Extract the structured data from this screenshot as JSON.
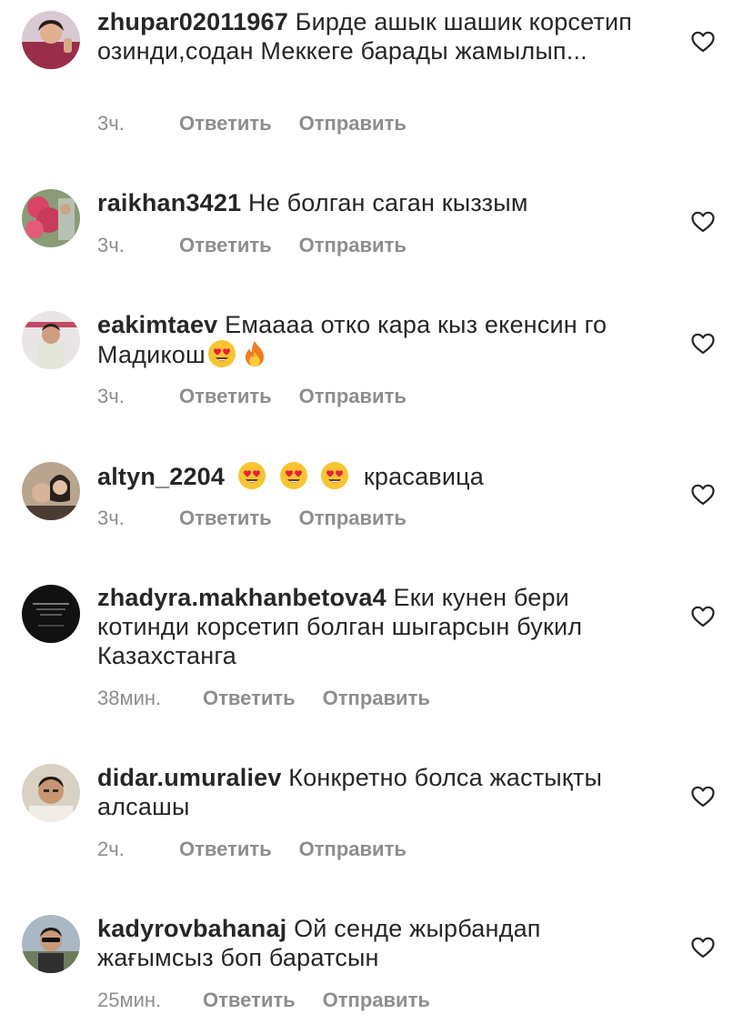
{
  "icons": {
    "like": "heart-outline-icon",
    "heart_eyes": "smiling-face-with-heart-eyes-emoji",
    "fire": "fire-emoji"
  },
  "colors": {
    "text": "#262626",
    "secondary": "#8e8e8e",
    "emoji_face": "#f9c432",
    "emoji_heart": "#e8213a",
    "fire_outer": "#f5791f",
    "fire_inner": "#ffcb3d"
  },
  "comments": [
    {
      "username": "zhupar02011967",
      "text": "Бирде ашык шашик корсетип озинди,содан Меккеге барады жамылып...",
      "time": "3ч.",
      "reply": "Ответить",
      "send": "Отправить"
    },
    {
      "username": "raikhan3421",
      "text": "Не болган саган кыззым",
      "time": "3ч.",
      "reply": "Ответить",
      "send": "Отправить"
    },
    {
      "username": "eakimtaev",
      "text": "Емаааа отко кара кыз екенсин го Мадикош",
      "time": "3ч.",
      "reply": "Ответить",
      "send": "Отправить"
    },
    {
      "username": "altyn_2204",
      "text": "красавица",
      "time": "3ч.",
      "reply": "Ответить",
      "send": "Отправить"
    },
    {
      "username": "zhadyra.makhanbetova4",
      "text": "Еки кунен бери котинди корсетип болган шыгарсын букил Казахстанга",
      "time": "38мин.",
      "reply": "Ответить",
      "send": "Отправить"
    },
    {
      "username": "didar.umuraliev",
      "text": "Конкретно болса жастықты алсашы",
      "time": "2ч.",
      "reply": "Ответить",
      "send": "Отправить"
    },
    {
      "username": "kadyrovbahanaj",
      "text": "Ой сенде жырбандап жағымсыз боп баратсын",
      "time": "25мин.",
      "reply": "Ответить",
      "send": "Отправить"
    }
  ]
}
